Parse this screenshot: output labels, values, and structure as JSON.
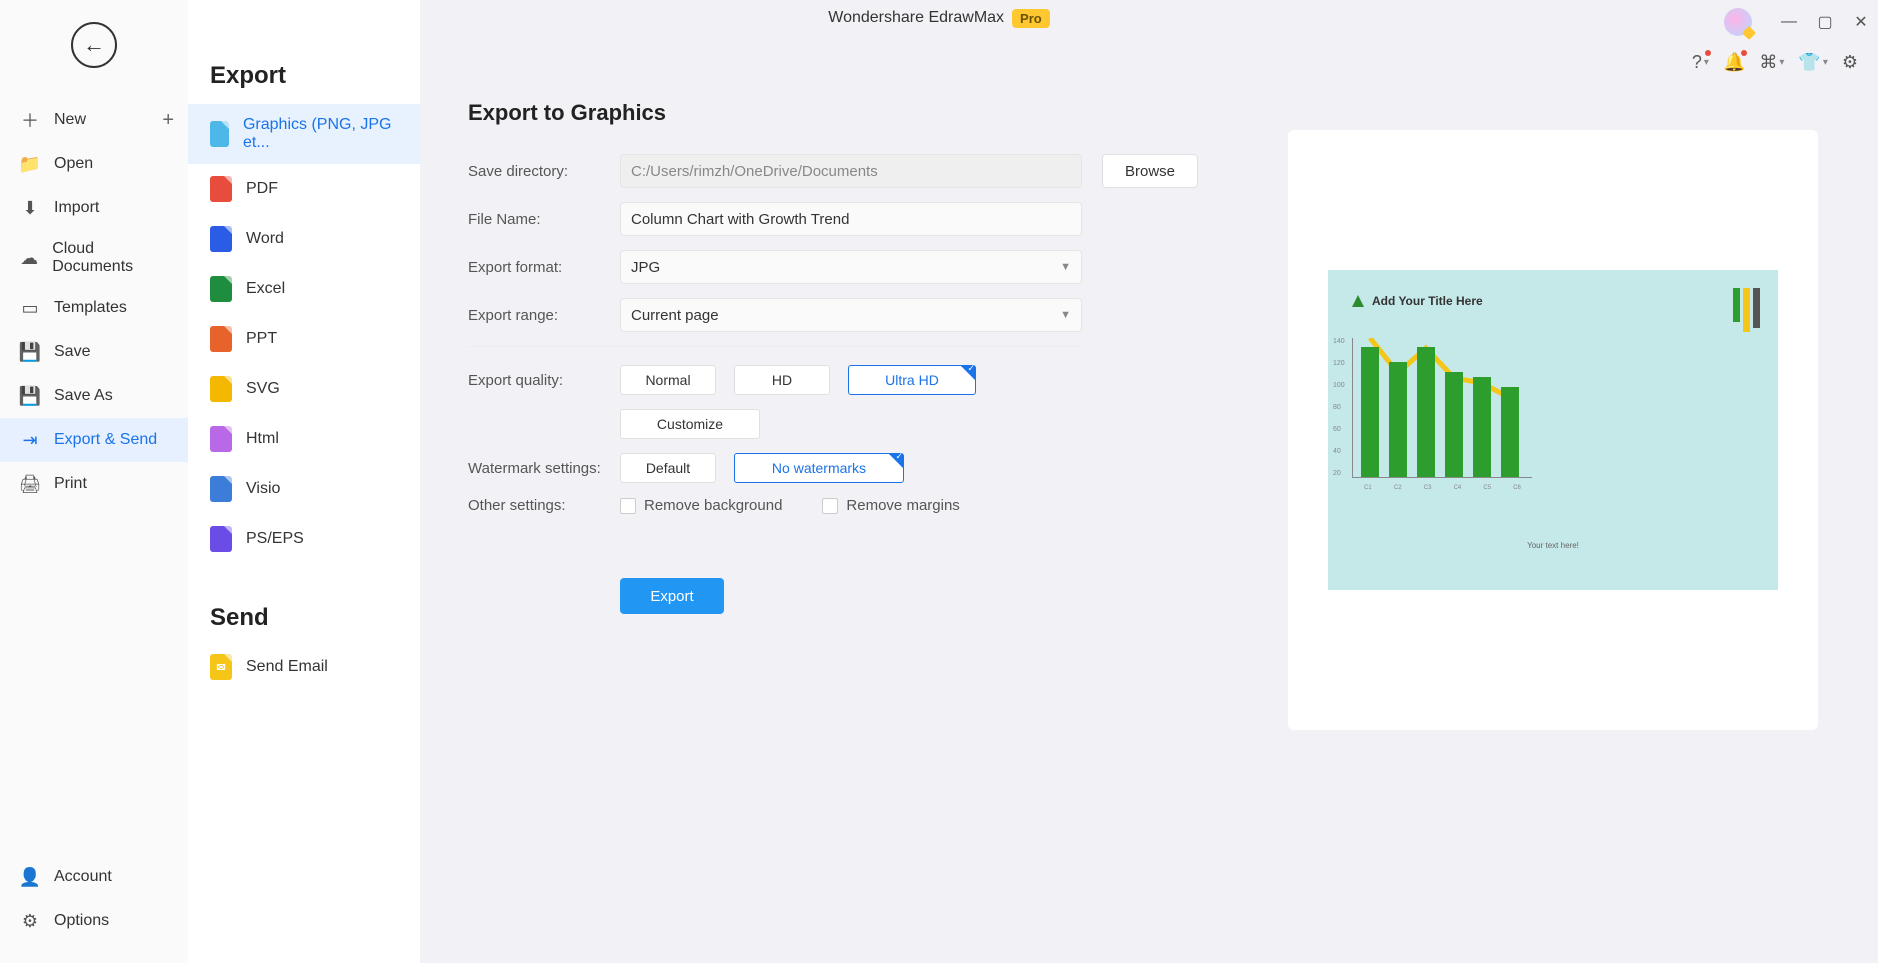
{
  "app": {
    "title": "Wondershare EdrawMax",
    "badge": "Pro"
  },
  "left_nav": {
    "items": [
      {
        "id": "new",
        "label": "New",
        "icon": "＋",
        "has_plus": true
      },
      {
        "id": "open",
        "label": "Open",
        "icon": "📁"
      },
      {
        "id": "import",
        "label": "Import",
        "icon": "⬇"
      },
      {
        "id": "cloud",
        "label": "Cloud Documents",
        "icon": "☁"
      },
      {
        "id": "templates",
        "label": "Templates",
        "icon": "▭"
      },
      {
        "id": "save",
        "label": "Save",
        "icon": "💾"
      },
      {
        "id": "saveas",
        "label": "Save As",
        "icon": "💾"
      },
      {
        "id": "export",
        "label": "Export & Send",
        "icon": "⇥",
        "active": true
      },
      {
        "id": "print",
        "label": "Print",
        "icon": "🖨"
      }
    ],
    "bottom": [
      {
        "id": "account",
        "label": "Account",
        "icon": "👤"
      },
      {
        "id": "options",
        "label": "Options",
        "icon": "⚙"
      }
    ]
  },
  "mid": {
    "export_heading": "Export",
    "send_heading": "Send",
    "formats": [
      {
        "id": "graphics",
        "label": "Graphics (PNG, JPG et...",
        "color": "#4db8e8",
        "selected": true
      },
      {
        "id": "pdf",
        "label": "PDF",
        "color": "#e74c3c"
      },
      {
        "id": "word",
        "label": "Word",
        "color": "#2b5ce6"
      },
      {
        "id": "excel",
        "label": "Excel",
        "color": "#1e8e3e"
      },
      {
        "id": "ppt",
        "label": "PPT",
        "color": "#e8622c"
      },
      {
        "id": "svg",
        "label": "SVG",
        "color": "#f5b800"
      },
      {
        "id": "html",
        "label": "Html",
        "color": "#b968e8"
      },
      {
        "id": "visio",
        "label": "Visio",
        "color": "#3b7dd8"
      },
      {
        "id": "pseps",
        "label": "PS/EPS",
        "color": "#6b4ce6"
      }
    ],
    "send_items": [
      {
        "id": "email",
        "label": "Send Email",
        "color": "#f5c518"
      }
    ]
  },
  "form": {
    "heading": "Export to Graphics",
    "labels": {
      "save_dir": "Save directory:",
      "file_name": "File Name:",
      "export_format": "Export format:",
      "export_range": "Export range:",
      "export_quality": "Export quality:",
      "watermark": "Watermark settings:",
      "other": "Other settings:"
    },
    "values": {
      "save_dir": "C:/Users/rimzh/OneDrive/Documents",
      "file_name": "Column Chart with Growth Trend",
      "export_format": "JPG",
      "export_range": "Current page"
    },
    "browse": "Browse",
    "quality": {
      "options": [
        "Normal",
        "HD",
        "Ultra HD"
      ],
      "selected": "Ultra HD",
      "customize": "Customize"
    },
    "watermark_opts": {
      "options": [
        "Default",
        "No watermarks"
      ],
      "selected": "No watermarks"
    },
    "other_opts": {
      "remove_bg": "Remove background",
      "remove_margins": "Remove margins"
    },
    "export_btn": "Export"
  },
  "preview": {
    "title": "Add Your Title Here",
    "subtitle": "Your text here!"
  },
  "chart_data": {
    "type": "bar",
    "title": "Add Your Title Here",
    "categories": [
      "Category 1",
      "Category 2",
      "Category 3",
      "Category 4",
      "Category 5",
      "Category 6"
    ],
    "values": [
      130,
      115,
      130,
      105,
      100,
      90
    ],
    "trend_line": [
      140,
      105,
      130,
      100,
      95,
      80
    ],
    "ylim": [
      0,
      140
    ],
    "y_ticks": [
      20,
      40,
      60,
      80,
      100,
      120,
      140
    ],
    "xlabel": "",
    "ylabel": "",
    "subtitle": "Your text here!",
    "bar_color": "#2d9d2d",
    "line_color": "#f5c518"
  }
}
